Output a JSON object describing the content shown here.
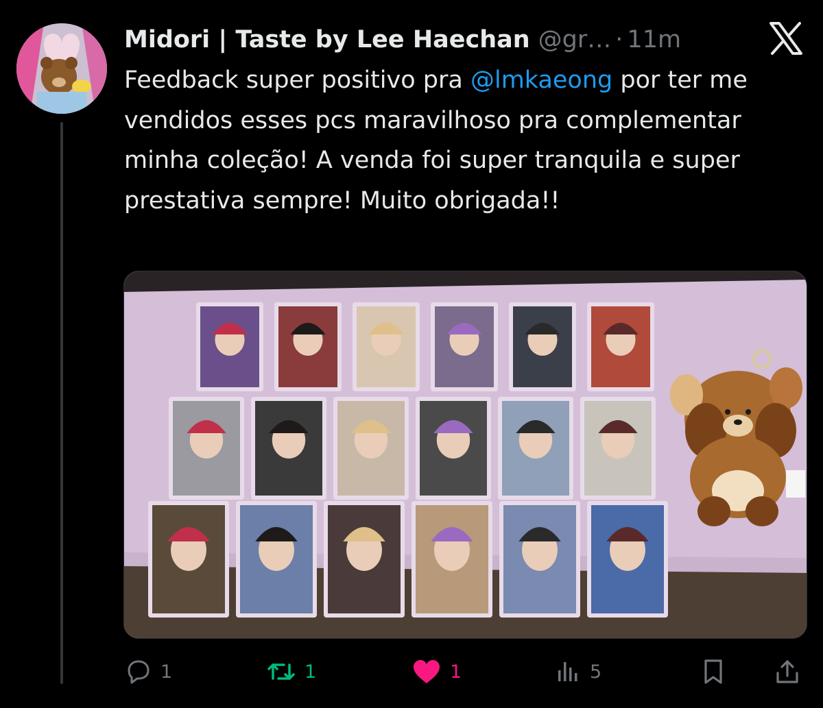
{
  "tweet": {
    "author_name": "Midori | Taste by Lee Haechan",
    "handle": "@gr…",
    "separator": "·",
    "time": "11m",
    "text_before": "Feedback super positivo pra ",
    "mention": "@lmkaeong",
    "text_after": " por ter me vendidos esses pcs maravilhoso pra complementar minha coleção! A venda foi super tranquila e super prestativa sempre! Muito obrigada!!"
  },
  "actions": {
    "reply_count": "1",
    "retweet_count": "1",
    "like_count": "1",
    "views_count": "5"
  },
  "colors": {
    "background": "#000000",
    "text": "#e7e9ea",
    "muted": "#71767b",
    "link": "#1d9bf0",
    "retweet": "#00ba7c",
    "like": "#f91880",
    "table": "#d6bfd9"
  },
  "icons": {
    "app_logo": "x-logo-icon",
    "reply": "reply-icon",
    "retweet": "retweet-icon",
    "like": "heart-icon",
    "views": "views-icon",
    "bookmark": "bookmark-icon",
    "share": "share-icon"
  }
}
